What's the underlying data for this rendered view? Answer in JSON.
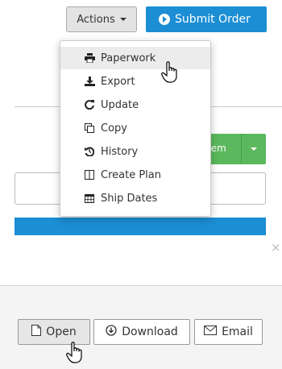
{
  "toolbar": {
    "actions_label": "Actions",
    "submit_label": "Submit Order"
  },
  "background": {
    "green_button_label": "tem"
  },
  "actions_menu": {
    "items": [
      {
        "label": "Paperwork",
        "icon": "print-icon"
      },
      {
        "label": "Export",
        "icon": "download-icon"
      },
      {
        "label": "Update",
        "icon": "refresh-icon"
      },
      {
        "label": "Copy",
        "icon": "copy-icon"
      },
      {
        "label": "History",
        "icon": "history-icon"
      },
      {
        "label": "Create Plan",
        "icon": "columns-icon"
      },
      {
        "label": "Ship Dates",
        "icon": "calendar-icon"
      }
    ]
  },
  "dialog": {
    "close_symbol": "×"
  },
  "footer": {
    "open_label": "Open",
    "download_label": "Download",
    "email_label": "Email"
  },
  "colors": {
    "primary": "#1b8ed4",
    "success": "#5cb85c"
  }
}
